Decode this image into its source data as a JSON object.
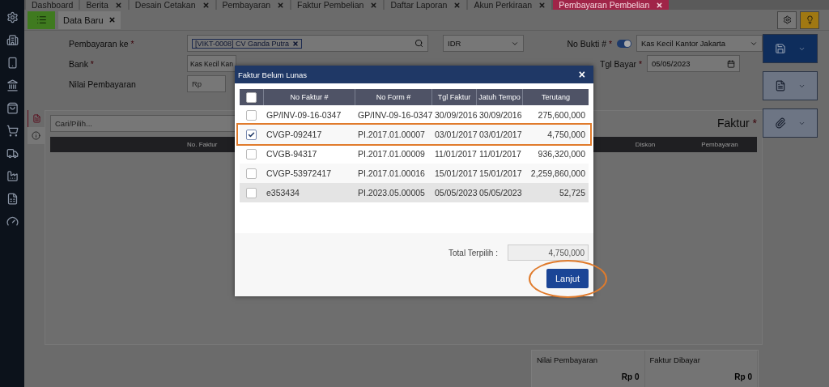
{
  "tabs": [
    {
      "label": "Dashboard",
      "closable": false,
      "selected": false
    },
    {
      "label": "Berita",
      "closable": true,
      "selected": false
    },
    {
      "label": "Desain Cetakan",
      "closable": true,
      "selected": false
    },
    {
      "label": "Pembayaran",
      "closable": true,
      "selected": false
    },
    {
      "label": "Faktur Pembelian",
      "closable": true,
      "selected": false
    },
    {
      "label": "Daftar Laporan",
      "closable": true,
      "selected": false
    },
    {
      "label": "Akun Perkiraan",
      "closable": true,
      "selected": false
    },
    {
      "label": "Pembayaran Pembelian",
      "closable": true,
      "selected": true
    }
  ],
  "subtab": {
    "label": "Data Baru",
    "closable": true
  },
  "form": {
    "supplier": {
      "label": "Pembayaran ke",
      "required_mark": "*",
      "tag": "[VIKT-0008] CV Ganda Putra"
    },
    "currency": "IDR",
    "number": {
      "label": "No Bukti #",
      "required_mark": "*",
      "auto": true,
      "value": "Kas Kecil Kantor Jakarta"
    },
    "bank": {
      "label": "Bank",
      "required_mark": "*",
      "value": "Kas Kecil Kan"
    },
    "date": {
      "label": "Tgl Bayar",
      "required_mark": "*",
      "value": "05/05/2023"
    },
    "amount": {
      "label": "Nilai Pembayaran",
      "placeholder": "Rp"
    }
  },
  "panel": {
    "search_placeholder": "Cari/Pilih...",
    "title": "Faktur",
    "title_required_mark": "*",
    "columns": [
      "No. Faktur",
      "Diskon",
      "Pembayaran"
    ]
  },
  "summary": [
    {
      "label": "Nilai Pembayaran",
      "value": "Rp 0"
    },
    {
      "label": "Faktur Dibayar",
      "value": "Rp 0"
    }
  ],
  "dialog": {
    "title": "Faktur Belum Lunas",
    "close": "×",
    "columns": [
      "No Faktur #",
      "No Form #",
      "Tgl Faktur",
      "Jatuh Tempo",
      "Terutang"
    ],
    "all_checked": false,
    "rows": [
      {
        "cells": [
          "GP/INV-09-16-0347",
          "GP/INV-09-16-0347",
          "30/09/2016",
          "30/09/2016",
          "275,600,000"
        ],
        "checked": false,
        "hovered": false,
        "circled": false
      },
      {
        "cells": [
          "CVGP-092417",
          "PI.2017.01.00007",
          "03/01/2017",
          "03/01/2017",
          "4,750,000"
        ],
        "checked": true,
        "hovered": false,
        "circled": true
      },
      {
        "cells": [
          "CVGB-94317",
          "PI.2017.01.00009",
          "11/01/2017",
          "11/01/2017",
          "936,320,000"
        ],
        "checked": false,
        "hovered": false,
        "circled": false
      },
      {
        "cells": [
          "CVGP-53972417",
          "PI.2017.01.00016",
          "15/01/2017",
          "15/01/2017",
          "2,259,860,000"
        ],
        "checked": false,
        "hovered": false,
        "circled": false
      },
      {
        "cells": [
          "e353434",
          "PI.2023.05.00005",
          "05/05/2023",
          "05/05/2023",
          "52,725"
        ],
        "checked": false,
        "hovered": true,
        "circled": false
      }
    ],
    "total_label": "Total Terpilih :",
    "total_value": "4,750,000",
    "button": "Lanjut",
    "button_circled": true
  }
}
